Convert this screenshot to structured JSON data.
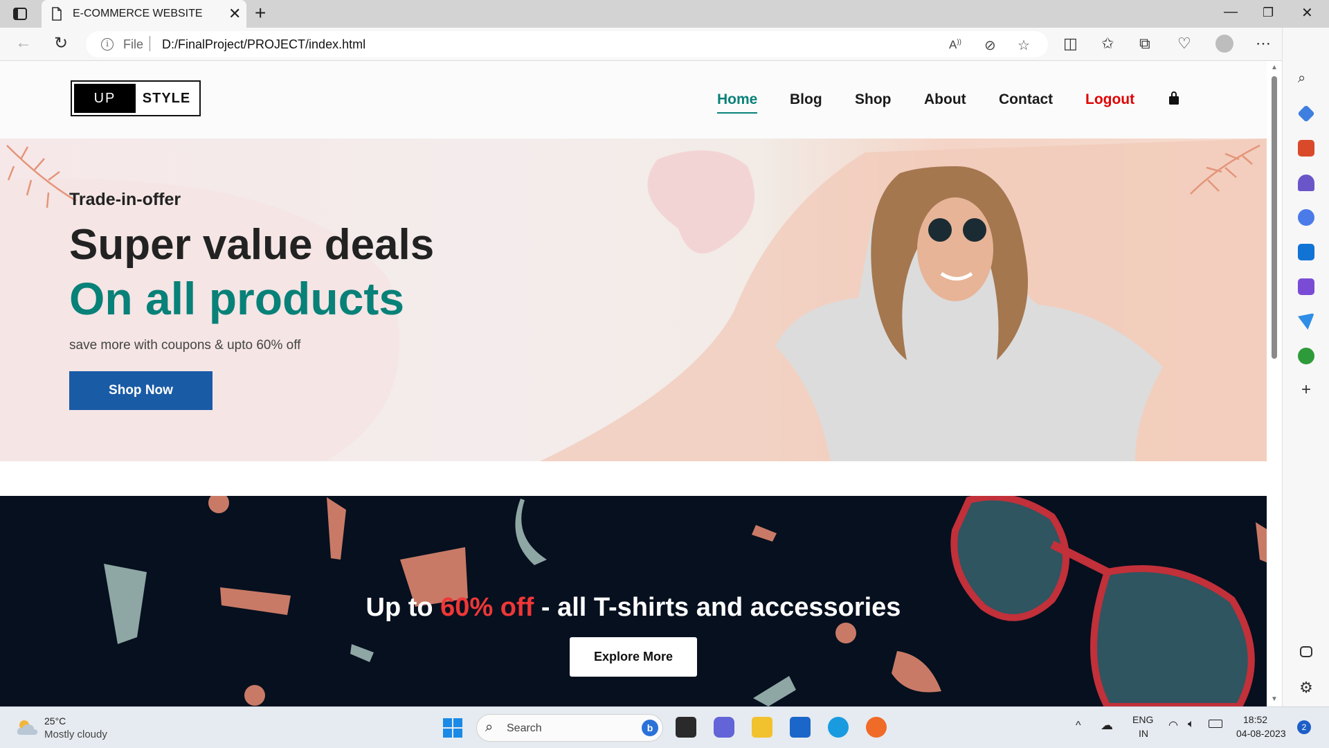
{
  "browser": {
    "tab_title": "E-COMMERCE WEBSITE",
    "address_prefix": "File",
    "url": "D:/FinalProject/PROJECT/index.html"
  },
  "site": {
    "logo": {
      "part1": "UP",
      "part2": "STYLE"
    },
    "nav": {
      "home": "Home",
      "blog": "Blog",
      "shop": "Shop",
      "about": "About",
      "contact": "Contact",
      "logout": "Logout"
    },
    "hero": {
      "kicker": "Trade-in-offer",
      "headline": "Super value deals",
      "headline_accent": "On all products",
      "subtitle": "save more with coupons & upto 60% off",
      "button": "Shop Now"
    },
    "banner": {
      "title_pre": "Up to ",
      "title_highlight": "60% off",
      "title_post": " - all T-shirts and accessories",
      "button": "Explore More"
    }
  },
  "taskbar": {
    "weather_temp": "25°C",
    "weather_desc": "Mostly cloudy",
    "search_label": "Search",
    "lang_top": "ENG",
    "lang_bottom": "IN",
    "time": "18:52",
    "date": "04-08-2023",
    "notification_count": "2"
  },
  "colors": {
    "accent_teal": "#088178",
    "button_blue": "#1a5ba6",
    "logout_red": "#e00000",
    "banner_bg": "#06101f",
    "highlight_red": "#ef3737"
  }
}
